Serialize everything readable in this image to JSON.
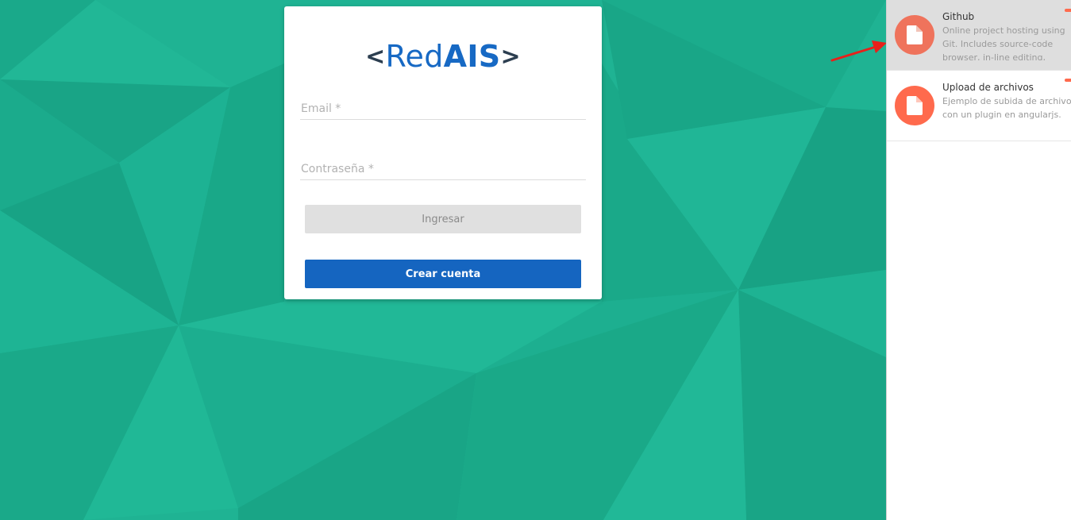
{
  "login": {
    "logo_open": "<",
    "logo_red": "Red",
    "logo_ais": "AIS",
    "logo_close": ">",
    "email_placeholder": "Email *",
    "password_placeholder": "Contraseña *",
    "login_button": "Ingresar",
    "create_button": "Crear cuenta"
  },
  "side_panel": {
    "items": [
      {
        "title": "Github",
        "desc_lines": [
          "Online project hosting using",
          "Git. Includes source-code",
          "browser, in-line editing,"
        ],
        "icon": "file-icon"
      },
      {
        "title": "Upload de archivos",
        "desc_lines": [
          "Ejemplo de subida de archivos",
          "con un plugin en angularjs."
        ],
        "icon": "file-icon"
      }
    ]
  },
  "colors": {
    "background": "#1fb393",
    "accent": "#1565c0",
    "avatar": "#ff6a4d",
    "arrow": "#e8201a"
  }
}
